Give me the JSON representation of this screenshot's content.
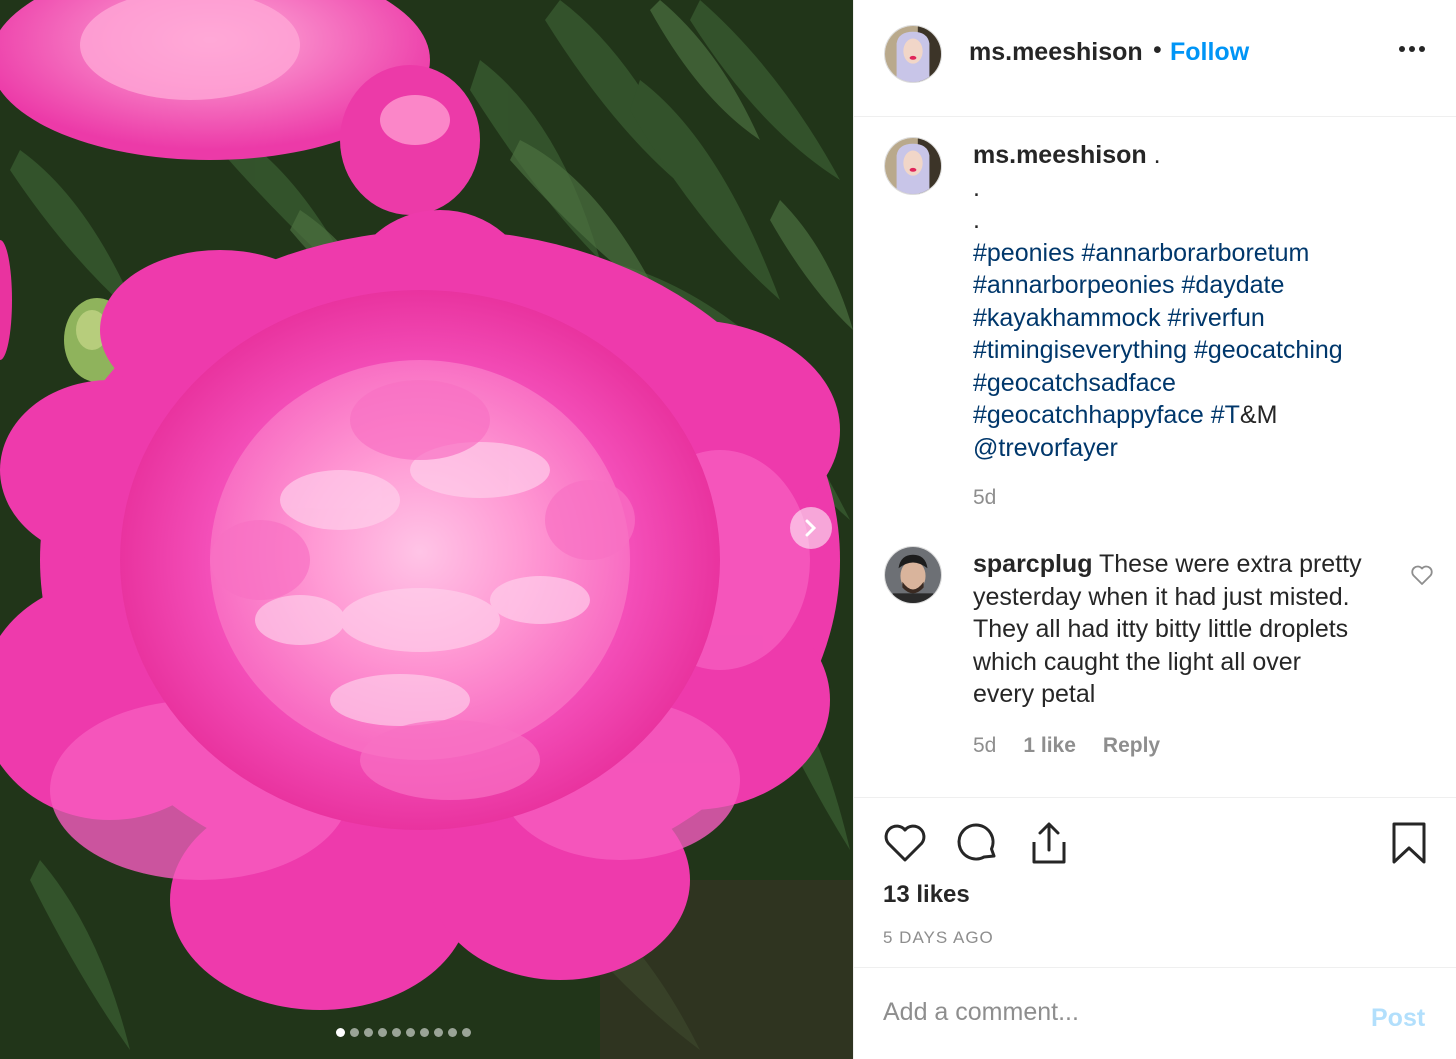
{
  "post": {
    "username": "ms.meeshison",
    "separator": "•",
    "follow_label": "Follow",
    "more_icon": "more-options-icon",
    "carousel": {
      "slide_count": 10,
      "active_index": 0,
      "next_icon": "chevron-right-icon"
    }
  },
  "caption": {
    "username": "ms.meeshison",
    "lines": [
      [
        {
          "t": " .",
          "tag": false
        }
      ],
      [
        {
          "t": ".",
          "tag": false
        }
      ],
      [
        {
          "t": ".",
          "tag": false
        }
      ],
      [
        {
          "t": "#peonies",
          "tag": true
        },
        {
          "t": " ",
          "tag": false
        },
        {
          "t": "#annarborarboretum",
          "tag": true
        }
      ],
      [
        {
          "t": "#annarborpeonies",
          "tag": true
        },
        {
          "t": " ",
          "tag": false
        },
        {
          "t": "#daydate",
          "tag": true
        }
      ],
      [
        {
          "t": "#kayakhammock",
          "tag": true
        },
        {
          "t": " ",
          "tag": false
        },
        {
          "t": "#riverfun",
          "tag": true
        }
      ],
      [
        {
          "t": "#timingiseverything",
          "tag": true
        },
        {
          "t": " ",
          "tag": false
        },
        {
          "t": "#geocatching",
          "tag": true
        }
      ],
      [
        {
          "t": "#geocatchsadface",
          "tag": true
        }
      ],
      [
        {
          "t": "#geocatchhappyface",
          "tag": true
        },
        {
          "t": " ",
          "tag": false
        },
        {
          "t": "#T",
          "tag": true
        },
        {
          "t": "&M",
          "tag": false
        }
      ],
      [
        {
          "t": "@trevorfayer",
          "tag": true
        }
      ]
    ],
    "time": "5d"
  },
  "comment": {
    "username": "sparcplug",
    "lines": [
      "These were extra pretty",
      "yesterday when it had just misted.",
      "They all had itty bitty little droplets",
      "which caught the light all over",
      "every petal"
    ],
    "time": "5d",
    "likes": "1 like",
    "reply_label": "Reply",
    "heart_icon": "heart-outline-icon"
  },
  "actions": {
    "like_icon": "heart-icon",
    "comment_icon": "comment-icon",
    "share_icon": "share-icon",
    "save_icon": "bookmark-icon",
    "likes_text": "13 likes",
    "timestamp": "5 DAYS AGO"
  },
  "add_comment": {
    "placeholder": "Add a comment...",
    "post_label": "Post"
  },
  "colors": {
    "accent": "#0095f6",
    "hashtag": "#00376b",
    "muted": "#8e8e8e",
    "post_disabled": "#b2dffc",
    "peony_pink": "#f23fb4",
    "foliage": "#2f4a28"
  }
}
